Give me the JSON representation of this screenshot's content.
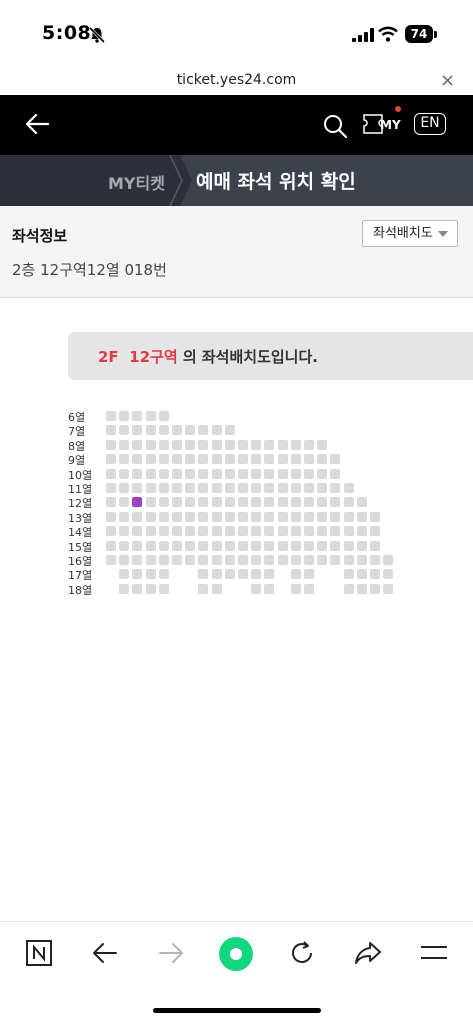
{
  "status_bar": {
    "time": "5:08",
    "battery": "74"
  },
  "browser": {
    "url": "ticket.yes24.com",
    "close": "×"
  },
  "header": {
    "my_label": "MY",
    "lang": "EN"
  },
  "breadcrumb": {
    "parent": "MY티켓",
    "title": "예매 좌석 위치 확인"
  },
  "seat_info": {
    "title": "좌석정보",
    "value": "2층 12구역12열 018번",
    "layout_button": "좌석배치도"
  },
  "banner": {
    "floor": "2F",
    "zone": "12구역",
    "suffix": "의 좌석배치도입니다."
  },
  "seat_map": {
    "rows": [
      "6열",
      "7열",
      "8열",
      "9열",
      "10열",
      "11열",
      "12열",
      "13열",
      "14열",
      "15열",
      "16열",
      "17열",
      "18열"
    ],
    "selected": {
      "row": "12열"
    }
  },
  "colors": {
    "accent_red": "#e23a44",
    "selected_seat": "#a13fcd",
    "seat": "#dadada"
  },
  "icons": [
    "back-arrow-icon",
    "search-icon",
    "ticket-my-icon",
    "bell-off-icon",
    "signal-icon",
    "wifi-icon",
    "naver-n-icon",
    "browser-back-icon",
    "browser-forward-icon",
    "green-dot-icon",
    "refresh-icon",
    "share-icon",
    "menu-icon"
  ]
}
